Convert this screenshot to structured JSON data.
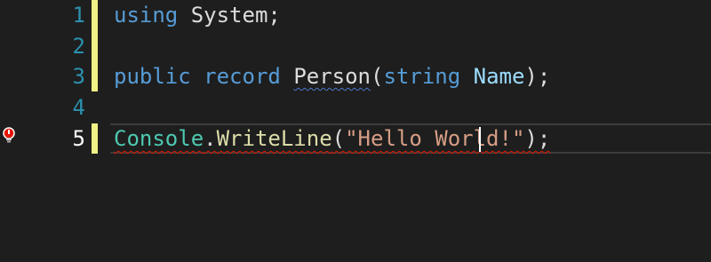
{
  "editor": {
    "line_numbers": [
      "1",
      "2",
      "3",
      "4",
      "5"
    ],
    "current_line": "5",
    "lines": {
      "l1": {
        "kw": "using",
        "rest": " System;"
      },
      "l3": {
        "kw1": "public",
        "kw2": "record",
        "name": "Person",
        "open": "(",
        "kw3": "string",
        "param": "Name",
        "close": ");"
      },
      "l5": {
        "type": "Console",
        "dot": ".",
        "method": "WriteLine",
        "open": "(",
        "str": "\"Hello World!\"",
        "close": ");"
      }
    },
    "colors": {
      "keyword": "#569cd6",
      "type": "#4ec9b0",
      "string": "#d69d85",
      "method": "#dcdcaa",
      "change_bar": "#eff284"
    },
    "gutter_icon": "lightbulb-error-icon"
  }
}
